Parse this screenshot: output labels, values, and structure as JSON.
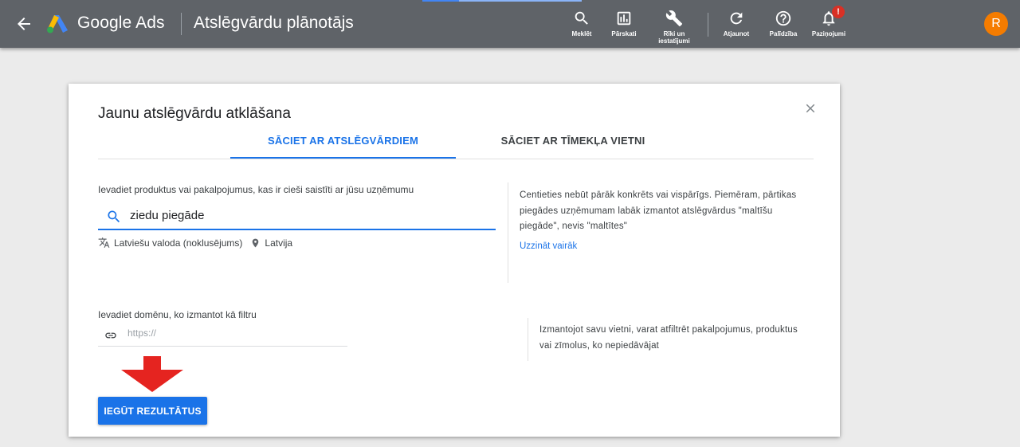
{
  "header": {
    "brand": "Google Ads",
    "page_title": "Atslēgvārdu plānotājs",
    "tools": [
      {
        "label": "Meklēt",
        "icon": "search-icon"
      },
      {
        "label": "Pārskati",
        "icon": "bar-chart-icon"
      },
      {
        "label": "Rīki un iestatījumi",
        "icon": "wrench-icon"
      },
      {
        "label": "Atjaunot",
        "icon": "refresh-icon"
      },
      {
        "label": "Palīdzība",
        "icon": "help-icon"
      },
      {
        "label": "Paziņojumi",
        "icon": "bell-icon"
      }
    ],
    "notification_badge": "!",
    "avatar_initial": "R"
  },
  "dialog": {
    "title": "Jaunu atslēgvārdu atklāšana",
    "tabs": [
      {
        "label": "SĀCIET AR ATSLĒGVĀRDIEM",
        "active": true
      },
      {
        "label": "SĀCIET AR TĪMEKĻA VIETNI",
        "active": false
      }
    ],
    "keywords_label": "Ievadiet produktus vai pakalpojumus, kas ir cieši saistīti ar jūsu uzņēmumu",
    "keywords_value": "ziedu piegāde",
    "language": "Latviešu valoda (noklusējums)",
    "location": "Latvija",
    "keywords_hint_lines": [
      "Centieties nebūt pārāk konkrēts vai vispārīgs. Piemēram, pārtikas",
      "piegādes uzņēmumam labāk izmantot atslēgvārdus \"maltīšu",
      "piegāde\", nevis \"maltītes\""
    ],
    "learn_more": "Uzzināt vairāk",
    "domain_label": "Ievadiet domēnu, ko izmantot kā filtru",
    "domain_placeholder": "https://",
    "domain_hint_lines": [
      "Izmantojot savu vietni, varat atfiltrēt pakalpojumus, produktus",
      "vai zīmolus, ko nepiedāvājat"
    ],
    "submit_label": "IEGŪT REZULTĀTUS"
  },
  "colors": {
    "topbar": "#5f6368",
    "accent": "#1a73e8",
    "arrow": "#e52420",
    "avatar": "#f57c00"
  }
}
